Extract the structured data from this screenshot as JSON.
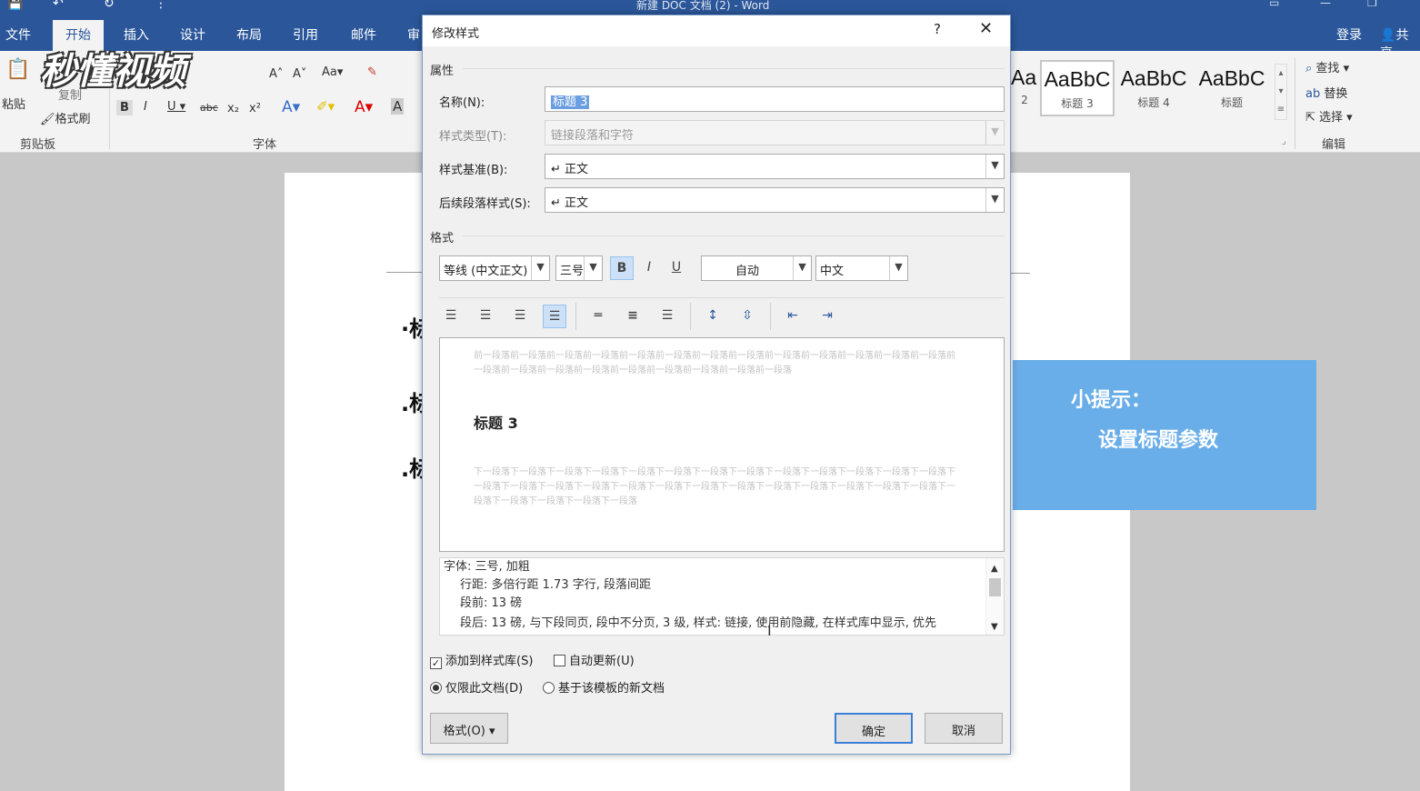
{
  "window": {
    "title": "新建 DOC 文档 (2) - Word"
  },
  "tabs": [
    "文件",
    "开始",
    "插入",
    "设计",
    "布局",
    "引用",
    "邮件",
    "审"
  ],
  "active_tab": "开始",
  "account": {
    "login": "登录",
    "share": "共享"
  },
  "ribbon": {
    "paste": "粘贴",
    "copy": "复制",
    "format_painter": "格式刷",
    "clipboard_group": "剪贴板",
    "font_group": "字体",
    "edit_group": "编辑",
    "find": "查找",
    "replace": "替换",
    "select": "选择",
    "style_gallery": [
      {
        "preview": "AaBbC",
        "name": "2"
      },
      {
        "preview": "AaBbC",
        "name": "标题 3"
      },
      {
        "preview": "AaBbC",
        "name": "标题 4"
      },
      {
        "preview": "AaBbC",
        "name": "标题"
      }
    ]
  },
  "watermark": "秒懂视频",
  "tip": {
    "line1": "小提示：",
    "line2": "设置标题参数"
  },
  "document": {
    "heading_fragments": [
      "·标",
      ".标",
      ".标"
    ]
  },
  "dialog": {
    "title": "修改样式",
    "help": "?",
    "close": "✕",
    "properties_section": "属性",
    "name_label": "名称(N):",
    "name_value": "标题 3",
    "style_type_label": "样式类型(T):",
    "style_type_value": "链接段落和字符",
    "based_on_label": "样式基准(B):",
    "based_on_value": "↵ 正文",
    "next_style_label": "后续段落样式(S):",
    "next_style_value": "↵ 正文",
    "format_section": "格式",
    "font": "等线 (中文正文)",
    "size": "三号",
    "color": "自动",
    "script": "中文",
    "preview_heading": "标题 3",
    "preview_before": "前一段落前一段落前一段落前一段落前一段落前一段落前一段落前一段落前一段落前一段落前一段落前一段落前一段落前一段落前一段落前一段落前一段落前一段落前一段落前一段落前一段落前一段落",
    "preview_after": "下一段落下一段落下一段落下一段落下一段落下一段落下一段落下一段落下一段落下一段落下一段落下一段落下一段落下一段落下一段落下一段落下一段落下一段落下一段落下一段落下一段落下一段落下一段落下一段落下一段落下一段落下一段落下一段落下一段落下一段落下一段落",
    "description": [
      "字体: 三号, 加粗",
      "行距: 多倍行距 1.73 字行, 段落间距",
      "段前: 13 磅",
      "段后: 13 磅, 与下段同页, 段中不分页, 3 级, 样式: 链接, 使用前隐藏, 在样式库中显示, 优先"
    ],
    "add_to_gallery": "添加到样式库(S)",
    "auto_update": "自动更新(U)",
    "only_this_doc": "仅限此文档(D)",
    "new_docs_template": "基于该模板的新文档",
    "format_button": "格式(O) ▾",
    "ok": "确定",
    "cancel": "取消"
  },
  "colors": {
    "accent": "#2b579a",
    "tip_bg": "#6aaee9",
    "selection": "#6b9ee0"
  }
}
